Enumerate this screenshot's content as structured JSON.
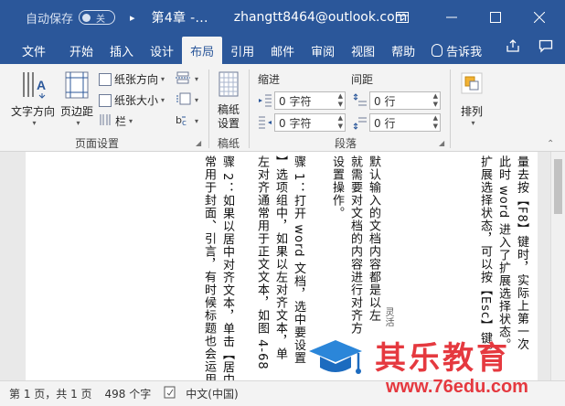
{
  "titlebar": {
    "autosave_label": "自动保存",
    "toggle_state": "关",
    "document_title": "第4章 -...",
    "account": "zhangtt8464@outlook.com"
  },
  "tabs": [
    {
      "label": "文件",
      "active": false
    },
    {
      "label": "开始",
      "active": false
    },
    {
      "label": "插入",
      "active": false
    },
    {
      "label": "设计",
      "active": false
    },
    {
      "label": "布局",
      "active": true
    },
    {
      "label": "引用",
      "active": false
    },
    {
      "label": "邮件",
      "active": false
    },
    {
      "label": "审阅",
      "active": false
    },
    {
      "label": "视图",
      "active": false
    },
    {
      "label": "帮助",
      "active": false
    }
  ],
  "tell_me": "告诉我",
  "ribbon": {
    "page_setup": {
      "label": "页面设置",
      "text_direction": "文字方向",
      "margins": "页边距",
      "orientation": "纸张方向",
      "size": "纸张大小",
      "columns": "栏"
    },
    "manuscript": {
      "label": "稿纸",
      "settings": "稿纸\n设置"
    },
    "paragraph": {
      "label": "段落",
      "indent_label": "缩进",
      "spacing_label": "间距",
      "indent_left": "0 字符",
      "indent_right": "0 字符",
      "spacing_before": "0 行",
      "spacing_after": "0 行"
    },
    "arrange": {
      "label": "排列"
    }
  },
  "document": {
    "columns": [
      "量去按【F8】键时，实际上第一次",
      "此时 word 进入了扩展选择状态。",
      "扩展选择状态，可以按【Esc】键。",
      "",
      "默认输入的文档内容都是以左",
      "就需要对文档的内容进行对齐方",
      "设置操作。",
      "",
      "骤 1：打开 word 文档，选中要设置",
      "】选项组中，如果以左对齐文本，单",
      "左对齐通常用于正文文本，如图 4-68",
      "",
      "骤 2：如果以居中对齐文本，单击【居中",
      "常用于封面、引言，有时候标题也会运用"
    ],
    "annotation": "灵活"
  },
  "status": {
    "page": "第 1 页，共 1 页",
    "words": "498 个字",
    "language": "中文(中国)"
  },
  "watermark": {
    "name": "其乐教育",
    "url": "www.76edu.com"
  }
}
